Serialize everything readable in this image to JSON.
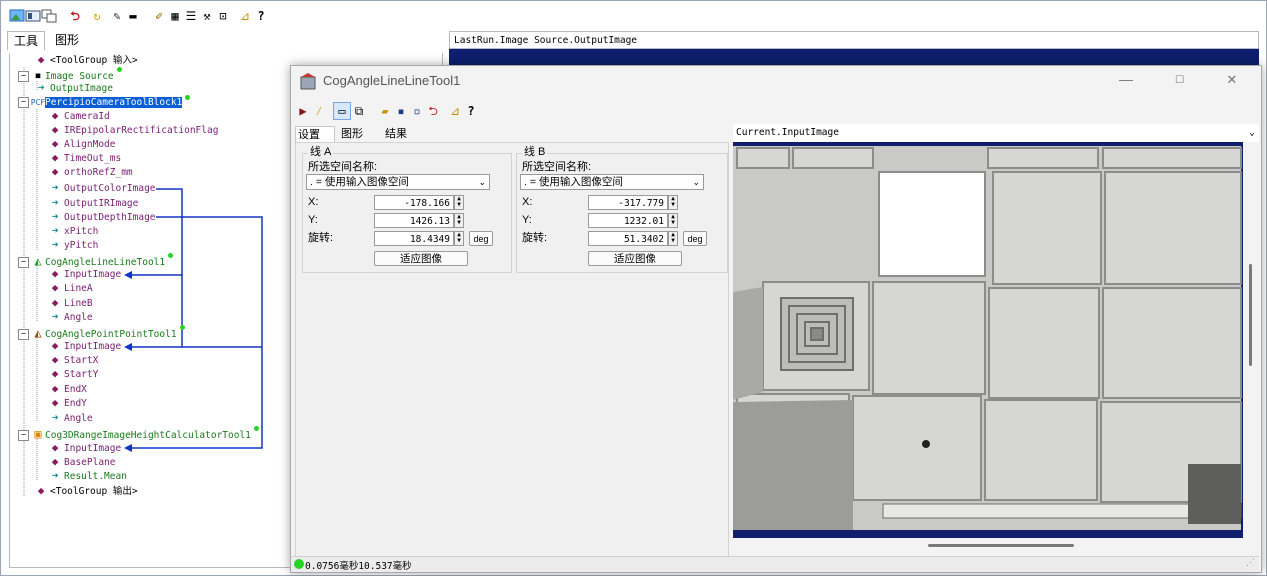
{
  "main": {
    "tabs": [
      "工具",
      "图形"
    ],
    "right_image_title": "LastRun.Image Source.OutputImage"
  },
  "tree": {
    "rows": [
      {
        "text": "<ToolGroup 输入>"
      },
      {
        "text": "Image Source"
      },
      {
        "text": "OutputImage"
      },
      {
        "text": "PercipioCameraToolBlock1"
      },
      {
        "text": "CameraId"
      },
      {
        "text": "IREpipolarRectificationFlag"
      },
      {
        "text": "AlignMode"
      },
      {
        "text": "TimeOut_ms"
      },
      {
        "text": "orthoRefZ_mm"
      },
      {
        "text": "OutputColorImage"
      },
      {
        "text": "OutputIRImage"
      },
      {
        "text": "OutputDepthImage"
      },
      {
        "text": "xPitch"
      },
      {
        "text": "yPitch"
      },
      {
        "text": "CogAngleLineLineTool1"
      },
      {
        "text": "InputImage"
      },
      {
        "text": "LineA"
      },
      {
        "text": "LineB"
      },
      {
        "text": "Angle"
      },
      {
        "text": "CogAnglePointPointTool1"
      },
      {
        "text": "InputImage"
      },
      {
        "text": "StartX"
      },
      {
        "text": "StartY"
      },
      {
        "text": "EndX"
      },
      {
        "text": "EndY"
      },
      {
        "text": "Angle"
      },
      {
        "text": "Cog3DRangeImageHeightCalculatorTool1"
      },
      {
        "text": "InputImage"
      },
      {
        "text": "BasePlane"
      },
      {
        "text": "Result.Mean"
      },
      {
        "text": "<ToolGroup 输出>"
      }
    ]
  },
  "dialog": {
    "title": "CogAngleLineLineTool1",
    "tabs": [
      "设置",
      "图形",
      "结果"
    ],
    "image_title": "Current.InputImage",
    "status": "0.0756毫秒10.537毫秒",
    "lineA": {
      "title": "线 A",
      "space_label": "所选空间名称:",
      "space_value": ". = 使用输入图像空间",
      "x_label": "X:",
      "x_value": "-178.166",
      "y_label": "Y:",
      "y_value": "1426.13",
      "rot_label": "旋转:",
      "rot_value": "18.4349",
      "unit": "deg",
      "fit_button": "适应图像"
    },
    "lineB": {
      "title": "线 B",
      "space_label": "所选空间名称:",
      "space_value": ". = 使用输入图像空间",
      "x_label": "X:",
      "x_value": "-317.779",
      "y_label": "Y:",
      "y_value": "1232.01",
      "rot_label": "旋转:",
      "rot_value": "51.3402",
      "unit": "deg",
      "fit_button": "适应图像"
    }
  },
  "colors": {
    "selection": "#0a5fd6",
    "connector": "#1533c8",
    "image_border": "#0f1f6e",
    "status_ok": "#25d325"
  }
}
